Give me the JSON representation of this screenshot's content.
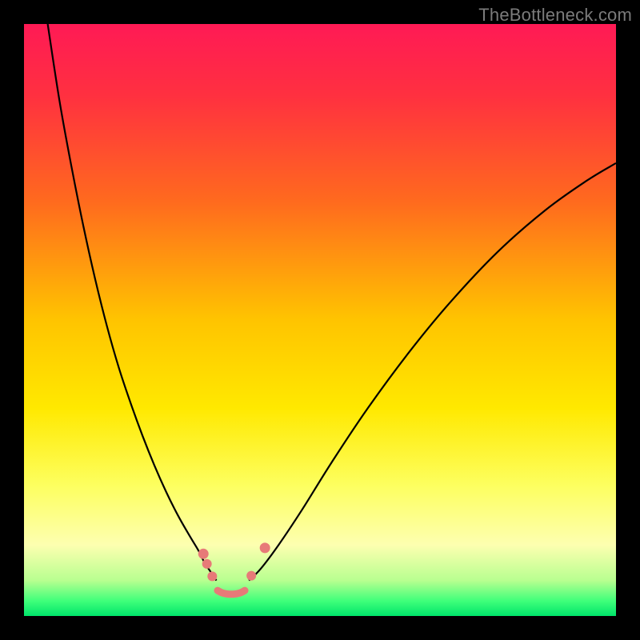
{
  "watermark": "TheBottleneck.com",
  "chart_data": {
    "type": "line",
    "title": "",
    "xlabel": "",
    "ylabel": "",
    "xlim": [
      0,
      100
    ],
    "ylim": [
      0,
      100
    ],
    "grid": false,
    "legend": false,
    "background_gradient": {
      "stops": [
        {
          "offset": 0.0,
          "color": "#ff1a55"
        },
        {
          "offset": 0.12,
          "color": "#ff3040"
        },
        {
          "offset": 0.3,
          "color": "#ff6a1e"
        },
        {
          "offset": 0.5,
          "color": "#ffc400"
        },
        {
          "offset": 0.65,
          "color": "#ffe900"
        },
        {
          "offset": 0.78,
          "color": "#fdff60"
        },
        {
          "offset": 0.88,
          "color": "#fdffb0"
        },
        {
          "offset": 0.94,
          "color": "#b8ff90"
        },
        {
          "offset": 0.975,
          "color": "#3eff7a"
        },
        {
          "offset": 1.0,
          "color": "#00e46a"
        }
      ]
    },
    "series": [
      {
        "name": "left-curve",
        "stroke": "#000000",
        "stroke_width": 2.2,
        "x": [
          4,
          6,
          8,
          10,
          12,
          14,
          16,
          18,
          20,
          22,
          24,
          26,
          28,
          29.5,
          30.5,
          31.5,
          32.5
        ],
        "y": [
          100,
          87,
          76,
          66,
          57,
          49,
          42,
          36,
          30.5,
          25.5,
          21,
          17,
          13.5,
          11,
          9,
          7.5,
          6
        ]
      },
      {
        "name": "right-curve",
        "stroke": "#000000",
        "stroke_width": 2.2,
        "x": [
          38,
          40,
          43,
          47,
          52,
          58,
          65,
          72,
          80,
          88,
          95,
          100
        ],
        "y": [
          6,
          8,
          12,
          18,
          26,
          35,
          44.5,
          53,
          61.5,
          68.5,
          73.5,
          76.5
        ]
      },
      {
        "name": "basin-fill",
        "type": "scatter",
        "stroke": "#e77a78",
        "stroke_width": 9,
        "linecap": "round",
        "x": [
          32.7,
          33.5,
          34.5,
          35.5,
          36.5,
          37.3
        ],
        "y": [
          4.3,
          3.9,
          3.7,
          3.7,
          3.9,
          4.3
        ]
      },
      {
        "name": "left-marker-upper",
        "type": "scatter",
        "marker": "circle",
        "color": "#e77a78",
        "radius": 6.5,
        "x": [
          30.3
        ],
        "y": [
          10.5
        ]
      },
      {
        "name": "left-marker-mid",
        "type": "scatter",
        "marker": "circle",
        "color": "#e77a78",
        "radius": 6,
        "x": [
          30.9
        ],
        "y": [
          8.8
        ]
      },
      {
        "name": "left-marker-low",
        "type": "scatter",
        "marker": "circle",
        "color": "#e77a78",
        "radius": 6,
        "x": [
          31.8
        ],
        "y": [
          6.7
        ]
      },
      {
        "name": "right-marker-upper",
        "type": "scatter",
        "marker": "circle",
        "color": "#e77a78",
        "radius": 6.5,
        "x": [
          40.7
        ],
        "y": [
          11.5
        ]
      },
      {
        "name": "right-marker-low",
        "type": "scatter",
        "marker": "circle",
        "color": "#e77a78",
        "radius": 6,
        "x": [
          38.4
        ],
        "y": [
          6.8
        ]
      }
    ]
  }
}
